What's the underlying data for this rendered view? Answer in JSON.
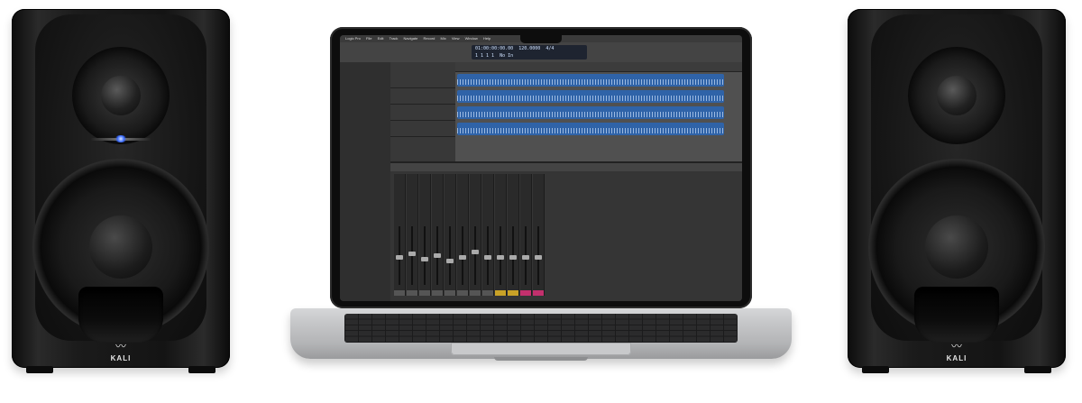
{
  "speakers": [
    {
      "position": "left",
      "brand_logo": "KALI"
    },
    {
      "position": "right",
      "brand_logo": "KALI"
    }
  ],
  "laptop": {
    "screen_app": "Logic Pro",
    "menubar_items": [
      "Logic Pro",
      "File",
      "Edit",
      "Track",
      "Navigate",
      "Record",
      "Mix",
      "View",
      "Window",
      "Help"
    ],
    "lcd_position": "01:00:00:00.00",
    "lcd_bars": "1 1 1 1",
    "lcd_tempo": "120.0000",
    "lcd_signature": "4/4",
    "lcd_key": "No In"
  },
  "colors": {
    "speaker_body": "#141414",
    "speaker_led": "#3a6bff",
    "laptop_aluminum": "#c5c6c8",
    "daw_region": "#2f63a8"
  }
}
